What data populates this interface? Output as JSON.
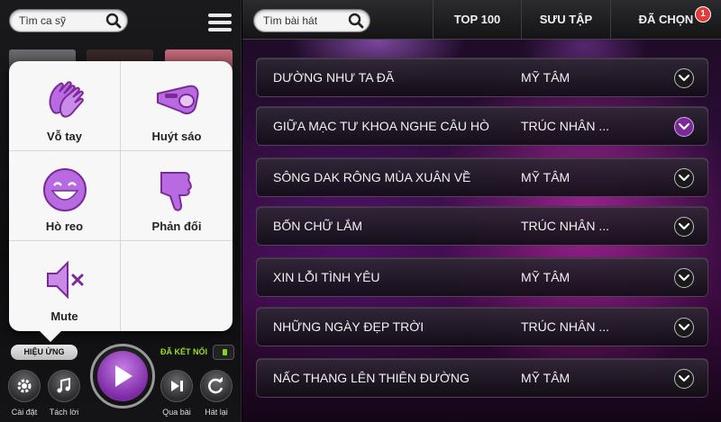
{
  "left_panel": {
    "artist_search_placeholder": "Tìm ca sỹ",
    "effects": [
      {
        "label": "Vỗ tay",
        "icon": "clapping-hands-icon"
      },
      {
        "label": "Huýt sáo",
        "icon": "whistle-icon"
      },
      {
        "label": "Hò reo",
        "icon": "cheering-face-icon"
      },
      {
        "label": "Phản đối",
        "icon": "thumbs-down-icon"
      },
      {
        "label": "Mute",
        "icon": "mute-speaker-icon"
      }
    ],
    "effects_tab_label": "HIỆU ỨNG",
    "connected_label": "ĐÃ KẾT NỐI",
    "controls": {
      "settings": "Cài đặt",
      "vocal": "Tách lời",
      "skip": "Qua bài",
      "replay": "Hát lại"
    }
  },
  "right_panel": {
    "song_search_placeholder": "Tìm bài hát",
    "tabs": [
      "TOP 100",
      "SƯU TẬP",
      "ĐÃ CHỌN"
    ],
    "selected_count": "1",
    "songs": [
      {
        "title": "DƯỜNG NHƯ TA ĐÃ",
        "artist": "MỸ TÂM",
        "expanded": false
      },
      {
        "title": "GIỮA MẠC TƯ KHOA NGHE CÂU HÒ",
        "artist": "TRÚC NHÂN ...",
        "expanded": true
      },
      {
        "title": "SÔNG DAK RÔNG MÙA XUÂN VỀ",
        "artist": "MỸ TÂM",
        "expanded": false
      },
      {
        "title": "BỐN CHỮ LẮM",
        "artist": "TRÚC NHÂN ...",
        "expanded": false
      },
      {
        "title": "XIN LỖI TÌNH YÊU",
        "artist": "MỸ TÂM",
        "expanded": false
      },
      {
        "title": "NHỮNG NGÀY ĐẸP TRỜI",
        "artist": "TRÚC NHÂN ...",
        "expanded": false
      },
      {
        "title": "NẤC THANG LÊN THIÊN ĐƯỜNG",
        "artist": "MỸ TÂM",
        "expanded": false
      }
    ]
  },
  "colors": {
    "accent": "#9b3fc6",
    "connected": "#9bdc2b",
    "badge": "#e23b3b"
  }
}
